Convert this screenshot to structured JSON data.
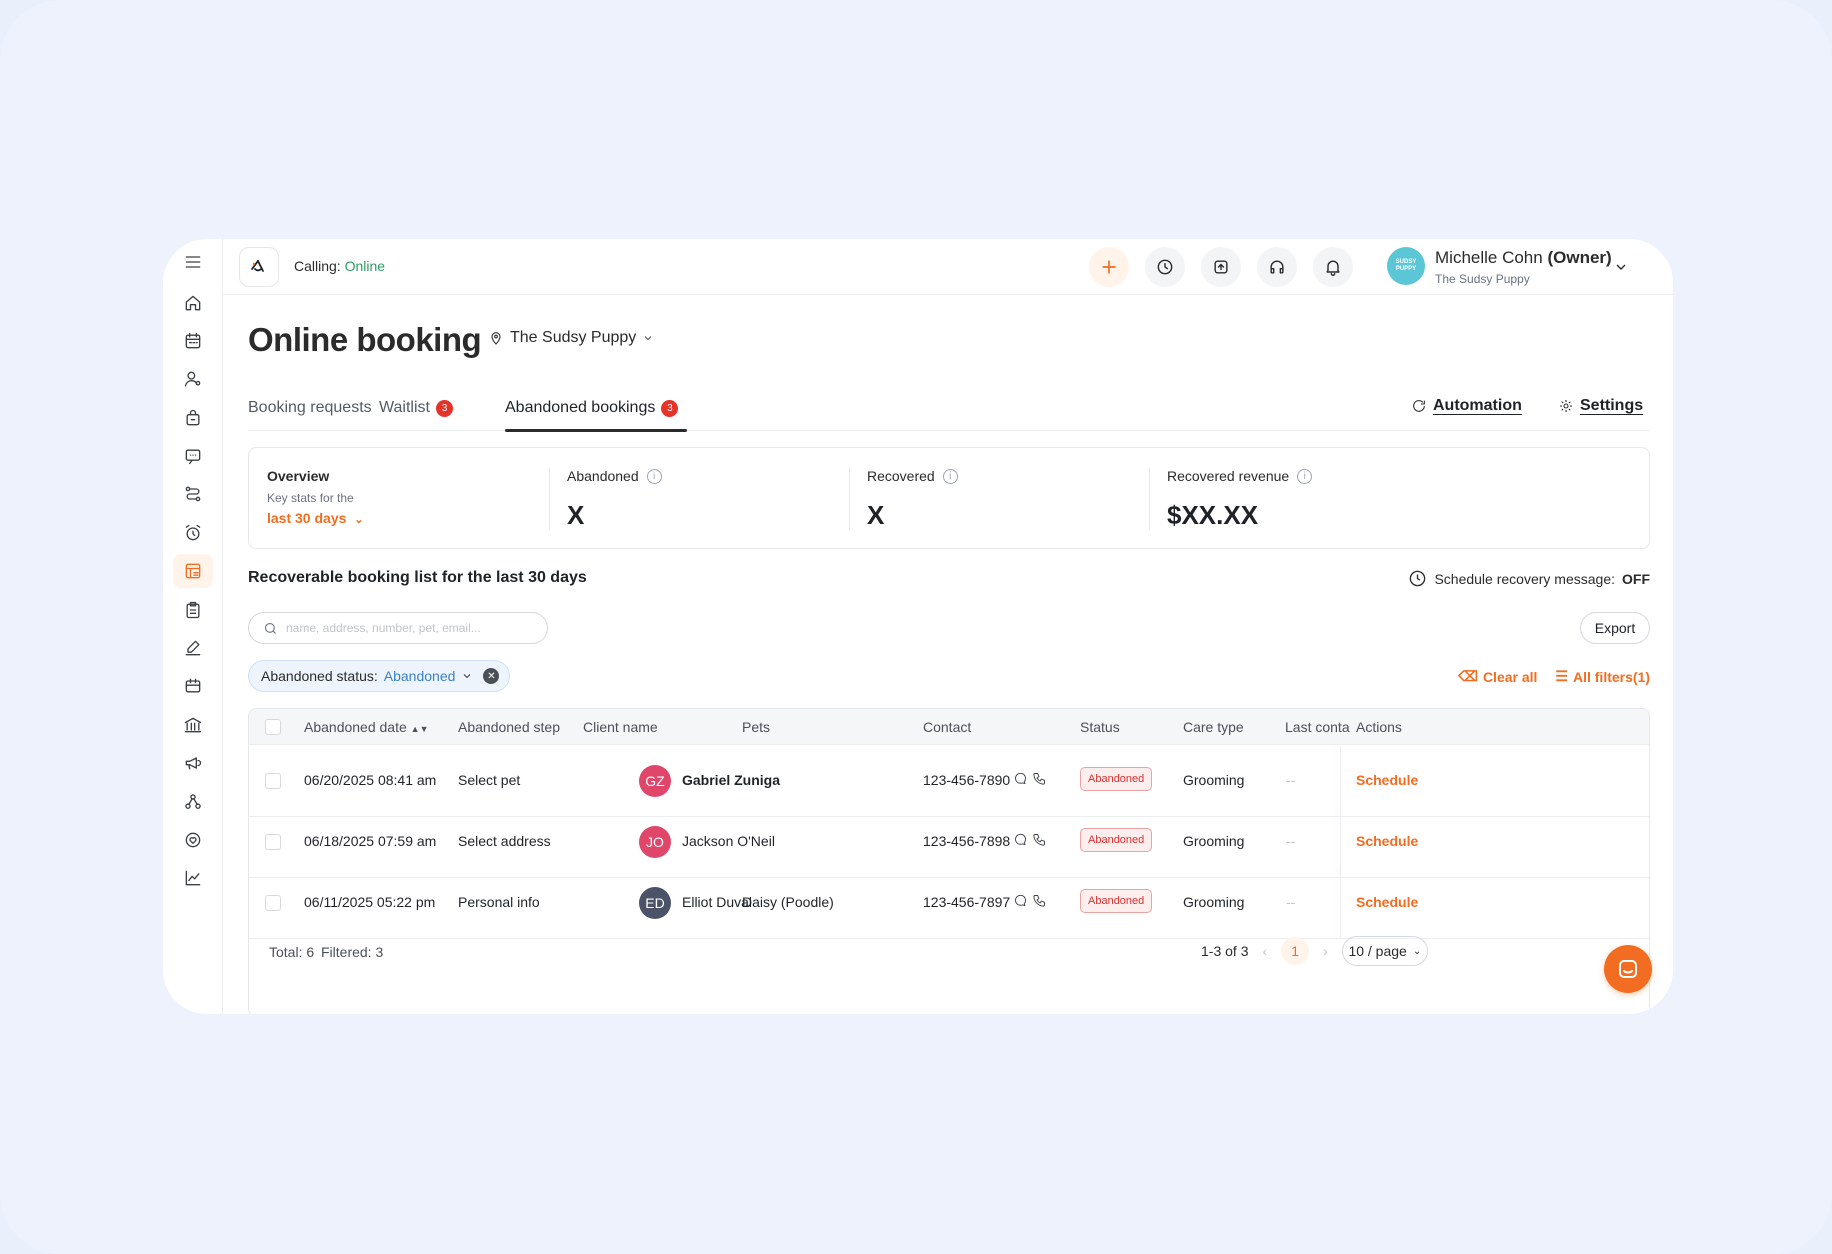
{
  "topbar": {
    "calling_label": "Calling:",
    "calling_status": "Online",
    "user_name": "Michelle Cohn",
    "user_role": "(Owner)",
    "user_business": "The Sudsy Puppy",
    "avatar_text": "SUDSY PUPPY"
  },
  "page": {
    "title": "Online booking",
    "location": "The Sudsy Puppy"
  },
  "tabs": [
    {
      "label": "Booking requests"
    },
    {
      "label": "Waitlist",
      "badge": "3"
    },
    {
      "label": "Abandoned bookings",
      "badge": "3",
      "active": true
    }
  ],
  "links": {
    "automation": "Automation",
    "settings": "Settings"
  },
  "overview": {
    "title": "Overview",
    "subtitle": "Key stats for the",
    "range": "last 30 days",
    "stats": [
      {
        "label": "Abandoned",
        "value": "X"
      },
      {
        "label": "Recovered",
        "value": "X"
      },
      {
        "label": "Recovered revenue",
        "value": "$XX.XX"
      }
    ]
  },
  "list": {
    "title": "Recoverable booking list for the last 30 days",
    "schedule_label": "Schedule recovery message:",
    "schedule_value": "OFF",
    "search_placeholder": "name, address, number, pet, email...",
    "export": "Export",
    "filter_label": "Abandoned status:",
    "filter_value": "Abandoned",
    "clear_all": "Clear all",
    "all_filters": "All filters(1)"
  },
  "table": {
    "columns": [
      "Abandoned date",
      "Abandoned step",
      "Client name",
      "Pets",
      "Contact",
      "Status",
      "Care type",
      "Last conta",
      "Actions"
    ],
    "rows": [
      {
        "date": "06/20/2025 08:41 am",
        "step": "Select pet",
        "initials": "GZ",
        "client": "Gabriel Zuniga",
        "pets": "",
        "contact": "123-456-7890",
        "status": "Abandoned",
        "care": "Grooming",
        "last": "--",
        "action": "Schedule",
        "color": "#e0466a"
      },
      {
        "date": "06/18/2025 07:59 am",
        "step": "Select address",
        "initials": "JO",
        "client": "Jackson O'Neil",
        "pets": "",
        "contact": "123-456-7898",
        "status": "Abandoned",
        "care": "Grooming",
        "last": "--",
        "action": "Schedule",
        "color": "#e0466a"
      },
      {
        "date": "06/11/2025 05:22 pm",
        "step": "Personal info",
        "initials": "ED",
        "client": "Elliot Duval",
        "pets": "Daisy (Poodle)",
        "contact": "123-456-7897",
        "status": "Abandoned",
        "care": "Grooming",
        "last": "--",
        "action": "Schedule",
        "color": "#4a5368"
      }
    ],
    "total": "Total: 6",
    "filtered": "Filtered: 3",
    "range": "1-3 of 3",
    "page": "1",
    "per_page": "10 / page"
  },
  "colors": {
    "accent": "#f26d21",
    "online": "#2e9d64",
    "badge": "#e5332a"
  }
}
